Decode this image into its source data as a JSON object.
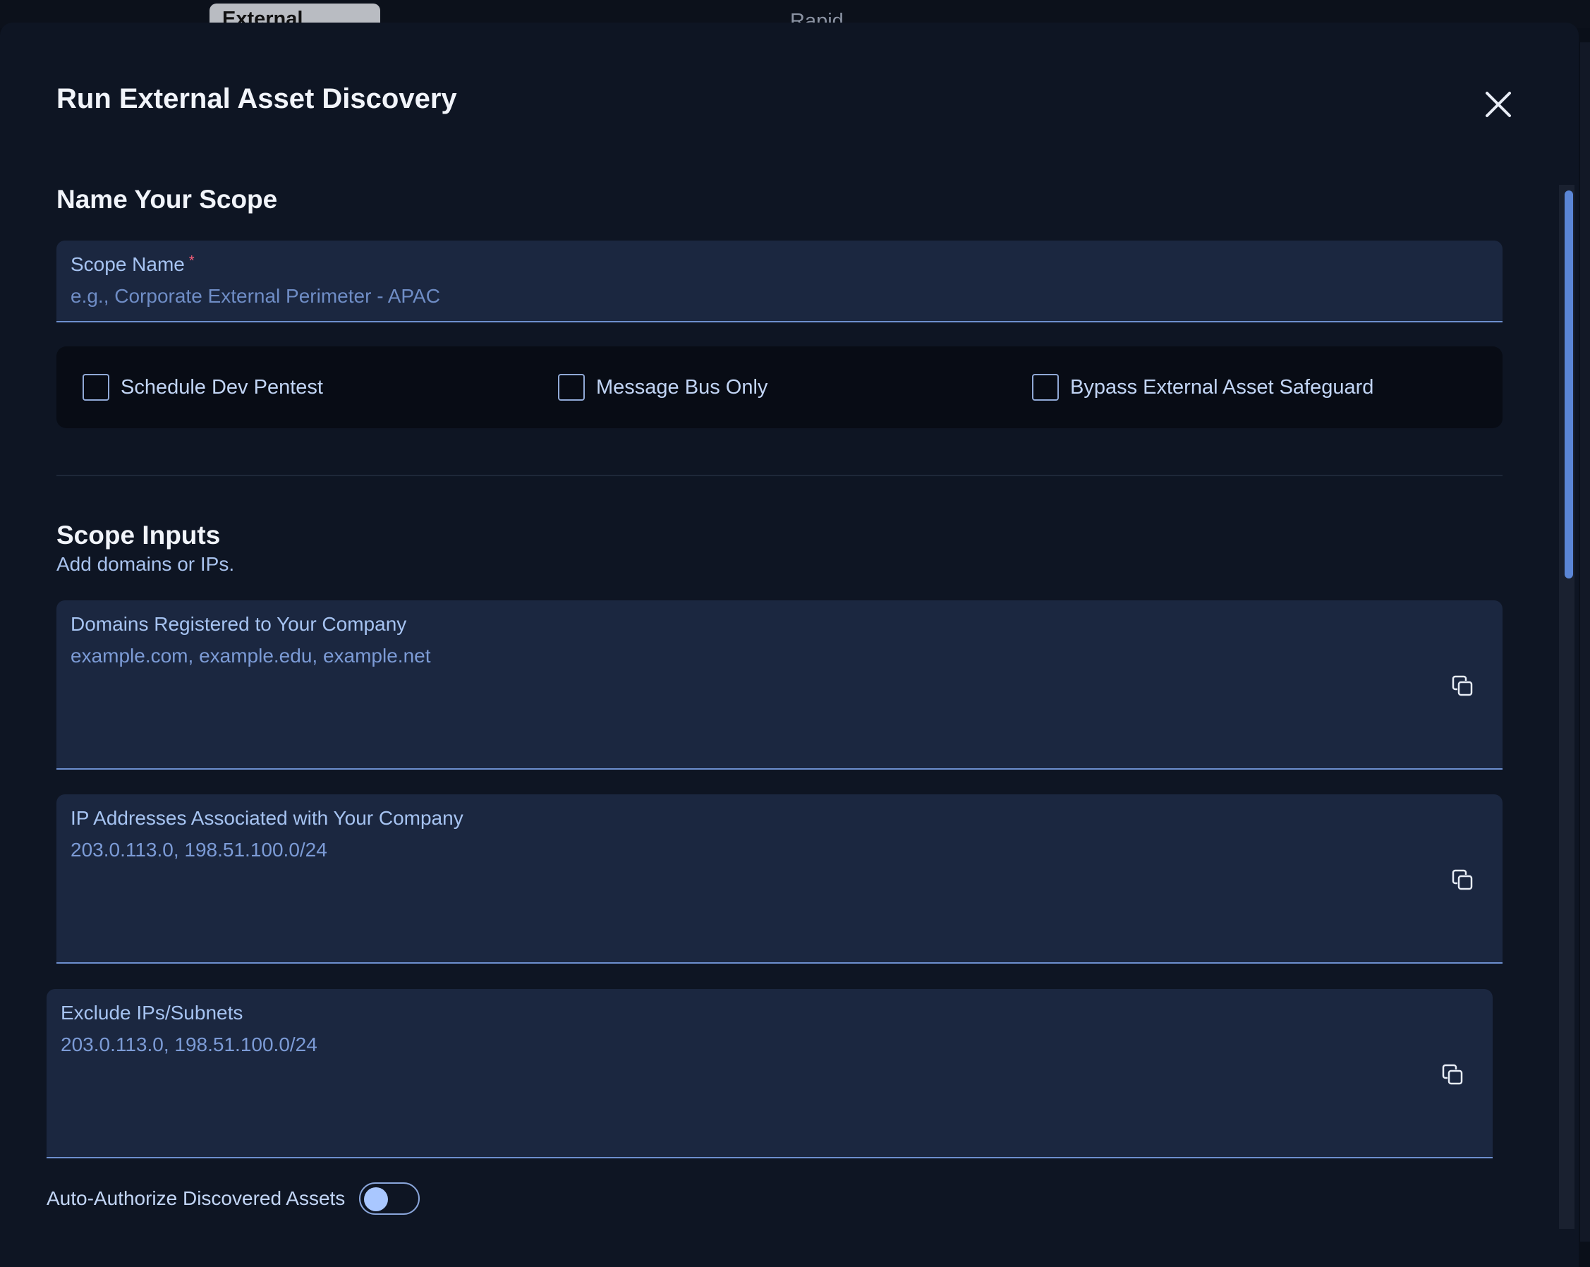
{
  "background_tabs": {
    "external": "External",
    "rapid": "Rapid"
  },
  "modal": {
    "title": "Run External Asset Discovery",
    "close_icon": "close-icon"
  },
  "name_section": {
    "title": "Name Your Scope",
    "scope_name": {
      "label": "Scope Name",
      "required_marker": "*",
      "placeholder": "e.g., Corporate External Perimeter - APAC",
      "value": ""
    }
  },
  "options": [
    {
      "label": "Schedule Dev Pentest",
      "checked": false
    },
    {
      "label": "Message Bus Only",
      "checked": false
    },
    {
      "label": "Bypass External Asset Safeguard",
      "checked": false
    }
  ],
  "inputs_section": {
    "title": "Scope Inputs",
    "subtitle": "Add domains or IPs.",
    "domains": {
      "label": "Domains Registered to Your Company",
      "placeholder": "example.com, example.edu, example.net",
      "icon": "copy-icon"
    },
    "ip_addresses": {
      "label": "IP Addresses Associated with Your Company",
      "placeholder": "203.0.113.0, 198.51.100.0/24",
      "icon": "copy-icon"
    },
    "exclude": {
      "label": "Exclude IPs/Subnets",
      "placeholder": "203.0.113.0, 198.51.100.0/24",
      "icon": "copy-icon"
    }
  },
  "auto_authorize": {
    "label": "Auto-Authorize Discovered Assets",
    "enabled": false
  },
  "colors": {
    "background": "#0e1523",
    "field": "#1b2740",
    "accent": "#6d8fcf",
    "required": "#ff5f7a"
  }
}
